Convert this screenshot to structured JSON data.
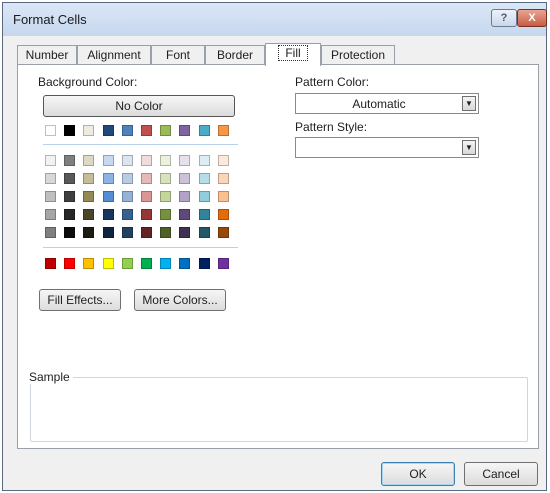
{
  "dialog": {
    "title": "Format Cells",
    "help_label": "?",
    "close_label": "X"
  },
  "tabs": [
    {
      "label": "Number"
    },
    {
      "label": "Alignment"
    },
    {
      "label": "Font"
    },
    {
      "label": "Border"
    },
    {
      "label": "Fill",
      "selected": true
    },
    {
      "label": "Protection"
    }
  ],
  "fill": {
    "background_color_label": "Background Color:",
    "no_color_label": "No Color",
    "theme_colors": [
      [
        "#FFFFFF",
        "#000000",
        "#EEECE1",
        "#1F497D",
        "#4F81BD",
        "#C0504D",
        "#9BBB59",
        "#8064A2",
        "#4BACC6",
        "#F79646"
      ],
      [
        "#F2F2F2",
        "#7F7F7F",
        "#DDD9C3",
        "#C6D9F0",
        "#DBE5F1",
        "#F2DCDB",
        "#EBF1DD",
        "#E5E0EC",
        "#DBEEF3",
        "#FDEADA"
      ],
      [
        "#D8D8D8",
        "#595959",
        "#C4BD97",
        "#8DB3E2",
        "#B8CCE4",
        "#E5B9B7",
        "#D7E3BC",
        "#CCC1D9",
        "#B7DDE8",
        "#FBD5B5"
      ],
      [
        "#BFBFBF",
        "#3F3F3F",
        "#938953",
        "#548DD4",
        "#95B3D7",
        "#D99694",
        "#C3D69B",
        "#B2A2C7",
        "#92CDDC",
        "#FAC08F"
      ],
      [
        "#A5A5A5",
        "#262626",
        "#494429",
        "#17365D",
        "#366092",
        "#953734",
        "#76923C",
        "#5F497A",
        "#31859B",
        "#E36C09"
      ],
      [
        "#7F7F7F",
        "#0C0C0C",
        "#1D1B10",
        "#0F243E",
        "#244061",
        "#632423",
        "#4F6128",
        "#3F3151",
        "#205867",
        "#974806"
      ]
    ],
    "standard_colors": [
      "#C00000",
      "#FF0000",
      "#FFC000",
      "#FFFF00",
      "#92D050",
      "#00B050",
      "#00B0F0",
      "#0070C0",
      "#002060",
      "#7030A0"
    ],
    "fill_effects_label": "Fill Effects...",
    "more_colors_label": "More Colors...",
    "pattern_color_label": "Pattern Color:",
    "pattern_color_value": "Automatic",
    "pattern_style_label": "Pattern Style:",
    "pattern_style_value": "",
    "sample_label": "Sample"
  },
  "footer": {
    "ok_label": "OK",
    "cancel_label": "Cancel"
  }
}
